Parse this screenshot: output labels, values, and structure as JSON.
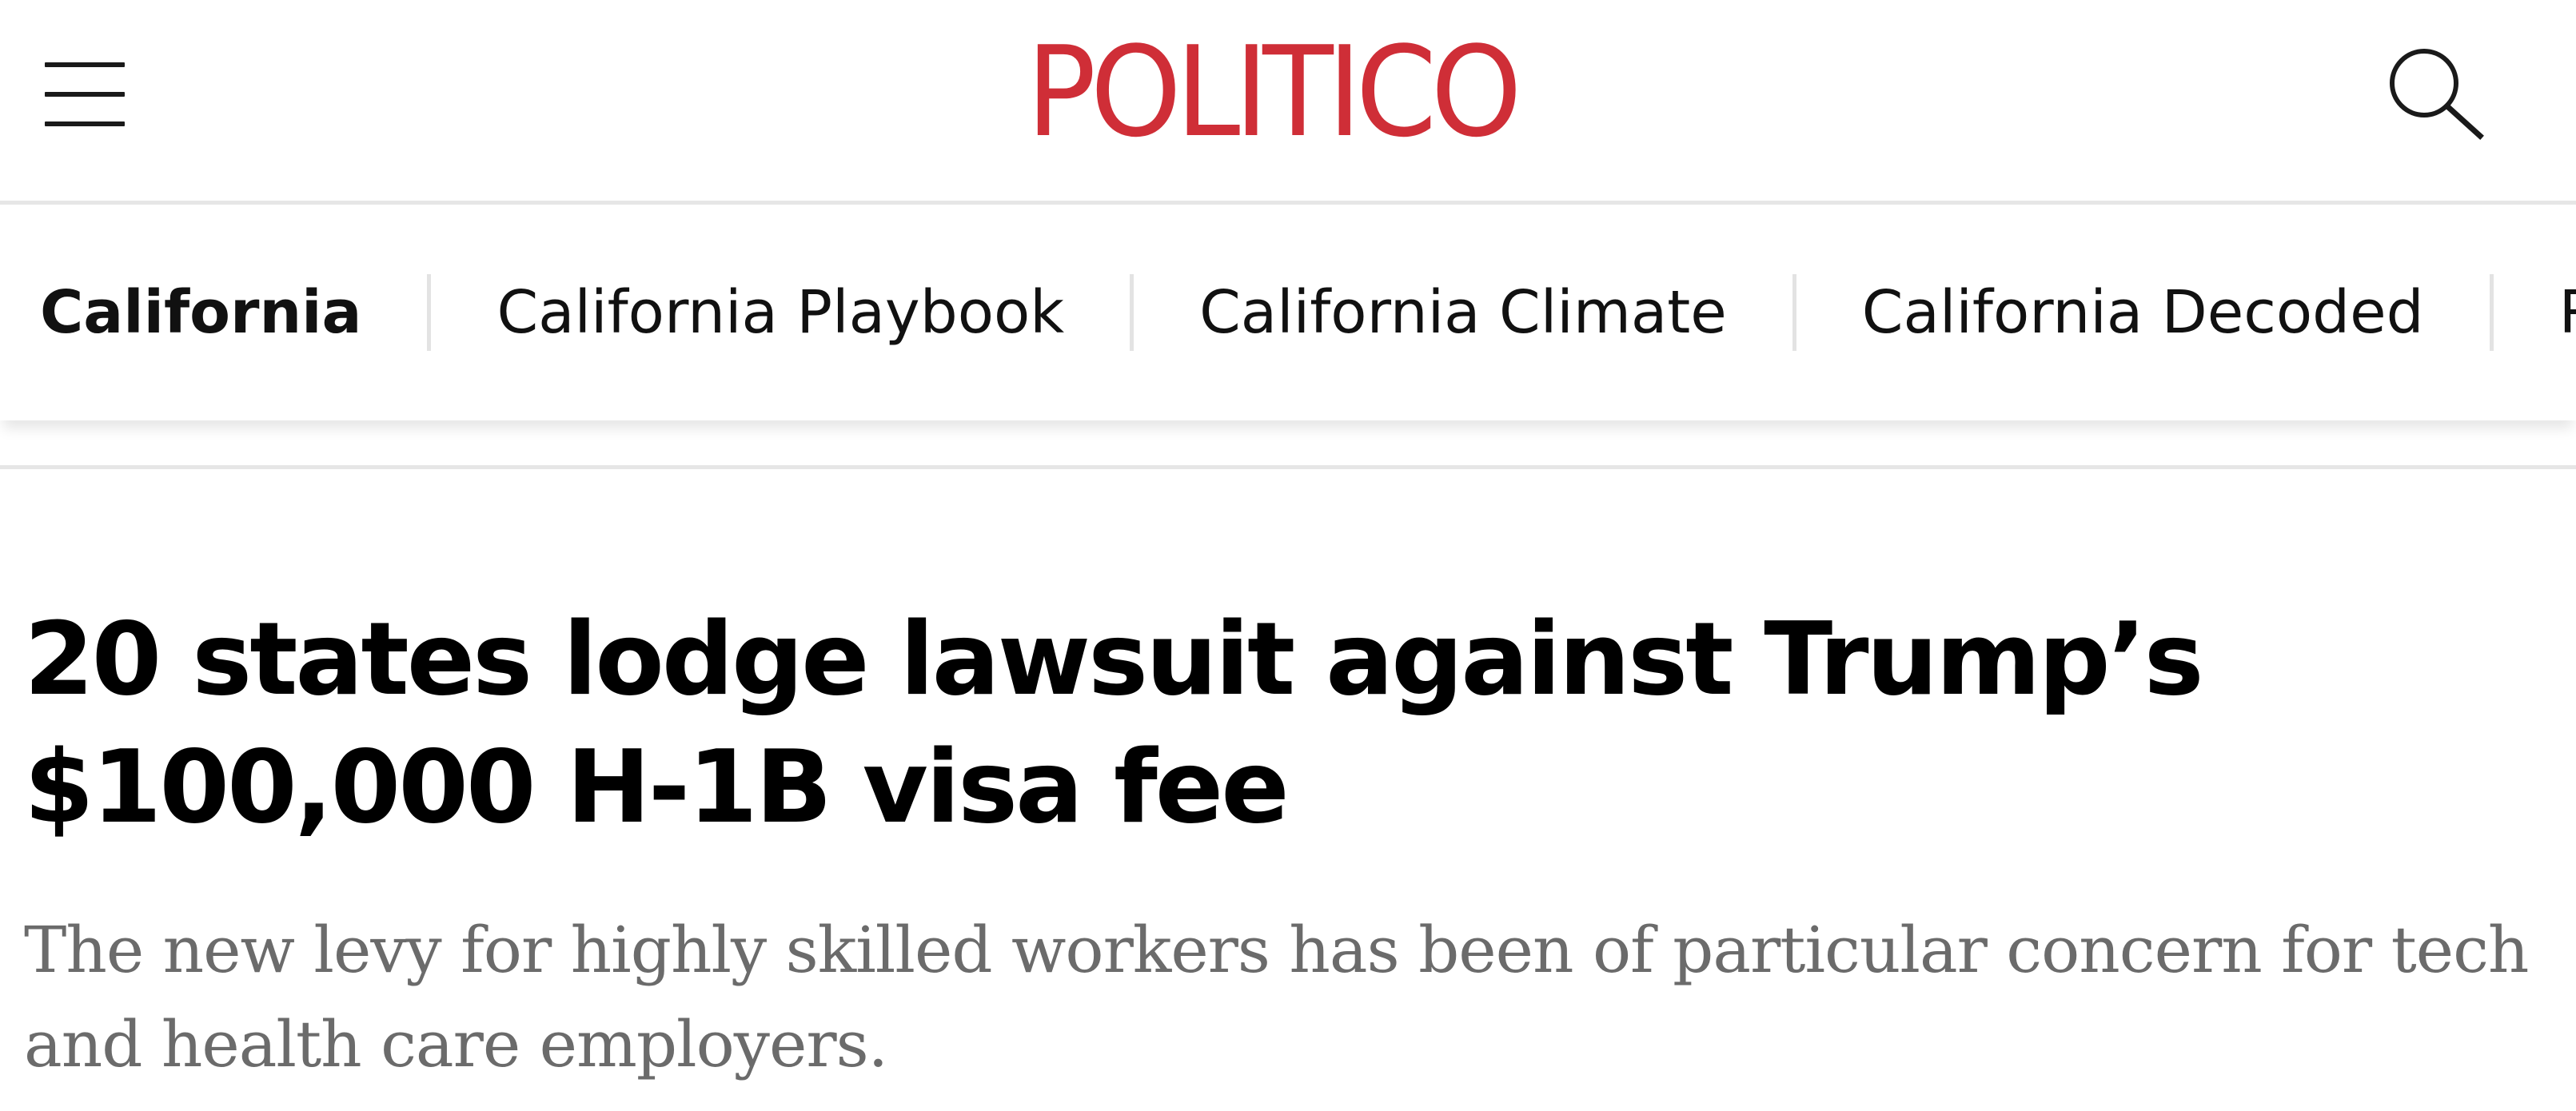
{
  "header": {
    "logo_text": "POLITICO",
    "brand_color": "#cf2e37",
    "menu_icon": "hamburger-menu-icon",
    "search_icon": "search-icon"
  },
  "nav": {
    "items": [
      {
        "label": "California",
        "active": true
      },
      {
        "label": "California Playbook",
        "active": false
      },
      {
        "label": "California Climate",
        "active": false
      },
      {
        "label": "California Decoded",
        "active": false
      },
      {
        "label": "Rebuild",
        "active": false
      }
    ]
  },
  "article": {
    "headline": "20 states lodge lawsuit against Trump’s $100,000 H-1B visa fee",
    "dek": "The new levy for highly skilled workers has been of particular concern for tech and health care employers."
  }
}
